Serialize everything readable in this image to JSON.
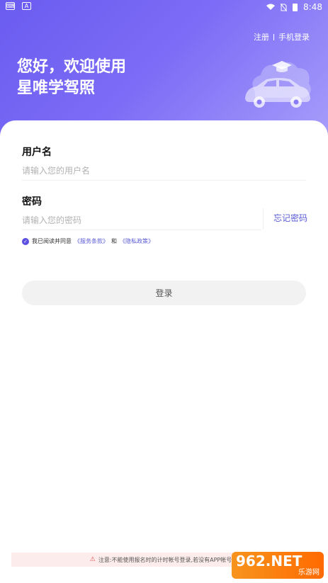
{
  "status_bar": {
    "time": "8:48",
    "left_icons": [
      "keyboard-icon",
      "font-a-icon"
    ],
    "right_icons": [
      "wifi-icon",
      "no-sim-icon",
      "battery-icon"
    ],
    "a_label": "A"
  },
  "header": {
    "register_link": "注册",
    "phone_login_link": "手机登录",
    "welcome_line1": "您好，欢迎使用",
    "welcome_line2": "星唯学驾照"
  },
  "form": {
    "username_label": "用户名",
    "username_placeholder": "请输入您的用户名",
    "password_label": "密码",
    "password_placeholder": "请输入您的密码",
    "forgot_password": "忘记密码"
  },
  "agreement": {
    "checked": true,
    "prefix": "我已阅读并同意",
    "terms": "《服务条款》",
    "and": "和",
    "privacy": "《隐私政策》"
  },
  "login_button": "登录",
  "notice": "注意:不能使用报名时的计时帐号登录,若没有APP帐号请",
  "watermark": {
    "brand": "962.NET",
    "sub": "乐游网"
  },
  "colors": {
    "brand_purple": "#6a5cf0",
    "link_blue": "#5b5bd6",
    "warning_red": "#e65050"
  }
}
